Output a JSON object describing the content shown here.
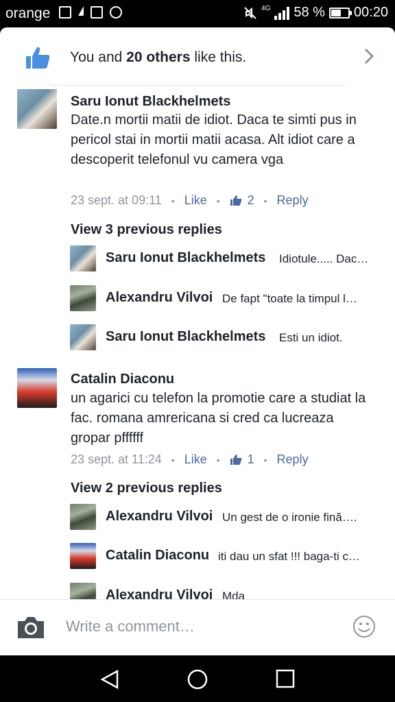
{
  "status_bar": {
    "carrier": "orange",
    "network": "4G",
    "battery": "58 %",
    "battery_level": 0.58,
    "time": "00:20"
  },
  "likes": {
    "prefix": "You and ",
    "bold": "20 others",
    "suffix": " like this."
  },
  "comments": [
    {
      "author": "Saru Ionut Blackhelmets",
      "text": "Date.n mortii matii de idiot. Daca te simti pus in pericol stai in mortii matii acasa. Alt idiot care a descoperit telefonul vu camera vga",
      "time": "23 sept. at 09:11",
      "like_label": "Like",
      "like_count": "2",
      "reply_label": "Reply",
      "view_previous": "View 3 previous replies",
      "replies": [
        {
          "author": "Saru Ionut Blackhelmets",
          "text": "Idiotule..... Dac…"
        },
        {
          "author": "Alexandru Vilvoi",
          "text": "De fapt \"toate la timpul l…"
        },
        {
          "author": "Saru Ionut Blackhelmets",
          "text": "Esti un idiot."
        }
      ]
    },
    {
      "author": "Catalin Diaconu",
      "text": "un agarici cu telefon la promotie care a studiat la fac. romana amrericana si cred ca lucreaza gropar pffffff",
      "time": "23 sept. at 11:24",
      "like_label": "Like",
      "like_count": "1",
      "reply_label": "Reply",
      "view_previous": "View 2 previous replies",
      "replies": [
        {
          "author": "Alexandru Vilvoi",
          "text": "Un gest de o ironie fină…."
        },
        {
          "author": "Catalin Diaconu",
          "text": "iti dau un sfat !!! baga-ti c…"
        },
        {
          "author": "Alexandru Vilvoi",
          "text": "Mda"
        }
      ]
    }
  ],
  "composer": {
    "placeholder": "Write a comment…"
  },
  "colors": {
    "link": "#4b6aa2",
    "meta": "#90949c",
    "like_blue": "#4267b2"
  }
}
